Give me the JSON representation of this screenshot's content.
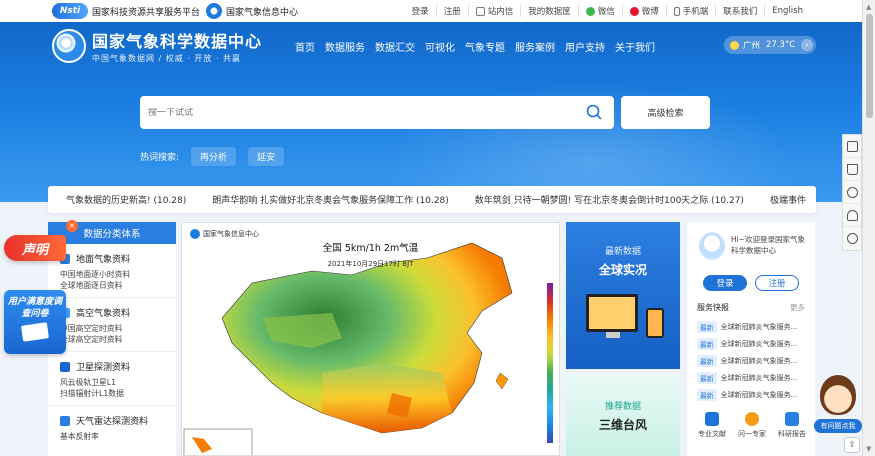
{
  "topbar": {
    "nsti_logo": "Nsti",
    "platform_name": "国家科技资源共享服务平台",
    "cma_name": "国家气象信息中心",
    "links": [
      "登录",
      "注册",
      "站内信",
      "我的数据筐",
      "微信",
      "微博",
      "手机端",
      "联系我们",
      "English"
    ]
  },
  "brand": {
    "title": "国家气象科学数据中心",
    "subtitle": "中国气象数据网 / 权威 · 开放 · 共赢"
  },
  "nav": [
    "首页",
    "数据服务",
    "数据汇交",
    "可视化",
    "气象专题",
    "服务案例",
    "用户支持",
    "关于我们"
  ],
  "weather": {
    "city": "广州",
    "temp": "27.3°C"
  },
  "search": {
    "placeholder": "搜一下试试",
    "advanced_label": "高级检索"
  },
  "hot": {
    "label": "热词搜索:",
    "tags": [
      "再分析",
      "延安"
    ]
  },
  "ticker": [
    "气象数据的历史新高! (10.28)",
    "朗声华韵响 扎实做好北京冬奥会气象服务保障工作 (10.28)",
    "数年筑剑 只待一朝梦圆! 写在北京冬奥会倒计时100天之际 (10.27)",
    "极端事件"
  ],
  "category": {
    "title": "数据分类体系",
    "groups": [
      {
        "name": "地面气象资料",
        "items": [
          "中国地面逐小时资料",
          "全球地面逐日资料"
        ]
      },
      {
        "name": "高空气象资料",
        "items": [
          "中国高空定时资料",
          "全球高空定时资料"
        ]
      },
      {
        "name": "卫星探测资料",
        "items": [
          "风云极轨卫星L1",
          "扫描辐射计L1数据"
        ]
      },
      {
        "name": "天气雷达探测资料",
        "items": [
          "基本反射率"
        ]
      }
    ]
  },
  "promos": {
    "declare": "声明",
    "survey": "用户满意度调查问卷"
  },
  "map": {
    "org": "国家气象信息中心",
    "title": "全国 5km/1h 2m气温",
    "time": "2021年10月29日17时  BJT"
  },
  "card_latest": {
    "kicker": "最新数据",
    "title": "全球实况"
  },
  "card_recommend": {
    "kicker": "推荐数据",
    "title": "三维台风"
  },
  "login": {
    "greeting": "Hi~欢迎登录国家气象科学数据中心",
    "login_label": "登录",
    "register_label": "注册",
    "section": "服务快报",
    "more": "更多",
    "news": [
      {
        "tag": "最新",
        "text": "全球新冠肺炎气象服务..."
      },
      {
        "tag": "最新",
        "text": "全球新冠肺炎气象服务..."
      },
      {
        "tag": "最新",
        "text": "全球新冠肺炎气象服务..."
      },
      {
        "tag": "最新",
        "text": "全球新冠肺炎气象服务..."
      },
      {
        "tag": "最新",
        "text": "全球新冠肺炎气象服务..."
      }
    ],
    "quick": [
      "专业文献",
      "问一专家",
      "科研报告"
    ]
  },
  "helper_label": "有问题点我",
  "colors": {
    "primary": "#1e72d8",
    "hero": "#1a7ee0",
    "accent_red": "#e8312a"
  }
}
